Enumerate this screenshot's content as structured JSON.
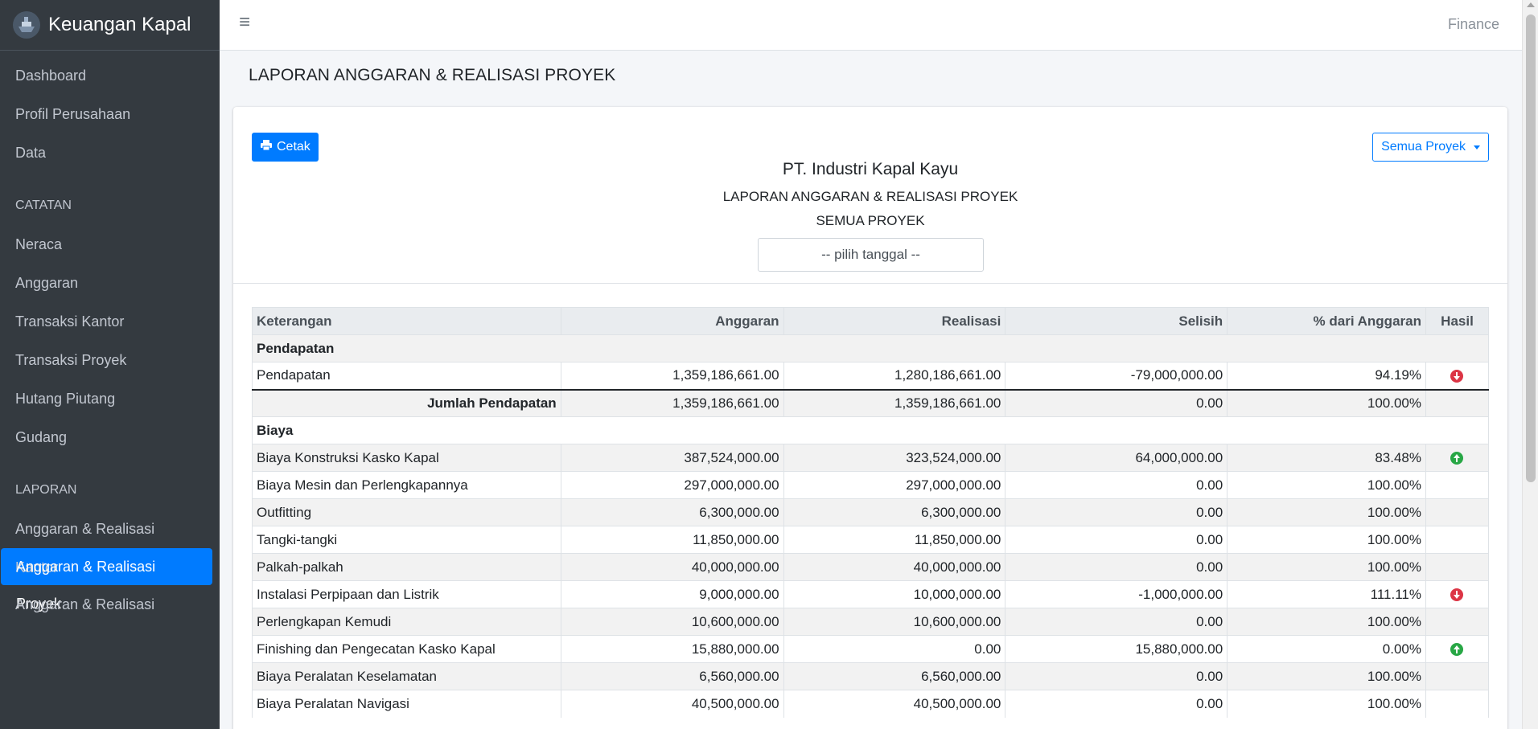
{
  "brand": {
    "title": "Keuangan Kapal",
    "logo_icon": "ship-icon"
  },
  "sidebar": {
    "items": [
      {
        "label": "Dashboard"
      },
      {
        "label": "Profil Perusahaan"
      },
      {
        "label": "Data"
      }
    ],
    "catatan_header": "CATATAN",
    "catatan_items": [
      {
        "label": "Neraca"
      },
      {
        "label": "Anggaran"
      },
      {
        "label": "Transaksi Kantor"
      },
      {
        "label": "Transaksi Proyek"
      },
      {
        "label": "Hutang Piutang"
      },
      {
        "label": "Gudang"
      }
    ],
    "laporan_header": "LAPORAN",
    "laporan_items": [
      {
        "label": "Anggaran & Realisasi Kantor"
      },
      {
        "label": "Anggaran & Realisasi Proyek",
        "active": true
      },
      {
        "label": "Anggaran & Realisasi"
      }
    ]
  },
  "topbar": {
    "menu_icon": "hamburger-icon",
    "user_label": "Finance"
  },
  "page": {
    "title": "LAPORAN ANGGARAN & REALISASI PROYEK"
  },
  "report": {
    "print_label": "Cetak",
    "print_icon": "printer-icon",
    "project_dropdown": "Semua Proyek",
    "company": "PT. Industri Kapal Kayu",
    "title": "LAPORAN ANGGARAN & REALISASI PROYEK",
    "subtitle": "SEMUA PROYEK",
    "date_placeholder": "-- pilih tanggal --"
  },
  "table": {
    "headers": [
      "Keterangan",
      "Anggaran",
      "Realisasi",
      "Selisih",
      "% dari Anggaran",
      "Hasil"
    ],
    "pendapatan_section": "Pendapatan",
    "pendapatan_row": {
      "label": "Pendapatan",
      "anggaran": "1,359,186,661.00",
      "realisasi": "1,280,186,661.00",
      "selisih": "-79,000,000.00",
      "persen": "94.19%",
      "hasil": "down"
    },
    "pendapatan_total": {
      "label": "Jumlah Pendapatan",
      "anggaran": "1,359,186,661.00",
      "realisasi": "1,359,186,661.00",
      "selisih": "0.00",
      "persen": "100.00%"
    },
    "biaya_section": "Biaya",
    "biaya_rows": [
      {
        "label": "Biaya Konstruksi Kasko Kapal",
        "anggaran": "387,524,000.00",
        "realisasi": "323,524,000.00",
        "selisih": "64,000,000.00",
        "persen": "83.48%",
        "hasil": "up"
      },
      {
        "label": "Biaya Mesin dan Perlengkapannya",
        "anggaran": "297,000,000.00",
        "realisasi": "297,000,000.00",
        "selisih": "0.00",
        "persen": "100.00%",
        "hasil": ""
      },
      {
        "label": "Outfitting",
        "anggaran": "6,300,000.00",
        "realisasi": "6,300,000.00",
        "selisih": "0.00",
        "persen": "100.00%",
        "hasil": ""
      },
      {
        "label": "Tangki-tangki",
        "anggaran": "11,850,000.00",
        "realisasi": "11,850,000.00",
        "selisih": "0.00",
        "persen": "100.00%",
        "hasil": ""
      },
      {
        "label": "Palkah-palkah",
        "anggaran": "40,000,000.00",
        "realisasi": "40,000,000.00",
        "selisih": "0.00",
        "persen": "100.00%",
        "hasil": ""
      },
      {
        "label": "Instalasi Perpipaan dan Listrik",
        "anggaran": "9,000,000.00",
        "realisasi": "10,000,000.00",
        "selisih": "-1,000,000.00",
        "persen": "111.11%",
        "hasil": "down"
      },
      {
        "label": "Perlengkapan Kemudi",
        "anggaran": "10,600,000.00",
        "realisasi": "10,600,000.00",
        "selisih": "0.00",
        "persen": "100.00%",
        "hasil": ""
      },
      {
        "label": "Finishing dan Pengecatan Kasko Kapal",
        "anggaran": "15,880,000.00",
        "realisasi": "0.00",
        "selisih": "15,880,000.00",
        "persen": "0.00%",
        "hasil": "up"
      },
      {
        "label": "Biaya Peralatan Keselamatan",
        "anggaran": "6,560,000.00",
        "realisasi": "6,560,000.00",
        "selisih": "0.00",
        "persen": "100.00%",
        "hasil": ""
      },
      {
        "label": "Biaya Peralatan Navigasi",
        "anggaran": "40,500,000.00",
        "realisasi": "40,500,000.00",
        "selisih": "0.00",
        "persen": "100.00%",
        "hasil": ""
      }
    ]
  }
}
